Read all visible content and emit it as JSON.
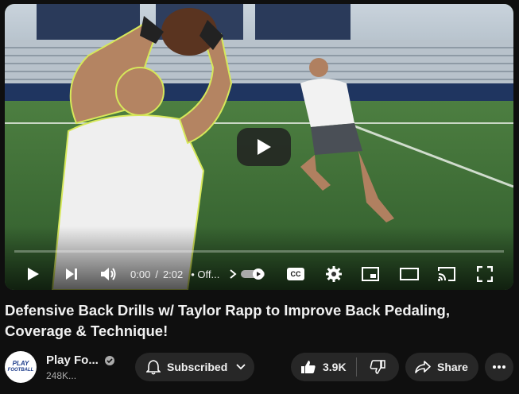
{
  "video": {
    "time_current": "0:00",
    "time_separator": "/",
    "time_total": "2:02",
    "chapter": "• Off...",
    "progress": 0.0,
    "cc_label": "CC"
  },
  "title": "Defensive Back Drills w/ Taylor Rapp to Improve Back Pedaling, Coverage & Technique!",
  "channel": {
    "name": "Play Fo...",
    "subscribers": "248K...",
    "logo_text_top": "PLAY",
    "logo_text_bottom": "FOOTBALL"
  },
  "actions": {
    "subscribe_label": "Subscribed",
    "like_count": "3.9K",
    "share_label": "Share"
  },
  "colors": {
    "accent": "#ff0000",
    "pill_bg": "#272727",
    "background": "#0f0f0f"
  },
  "icons": [
    "play-icon",
    "next-icon",
    "volume-icon",
    "chevron-right-icon",
    "autoplay-toggle",
    "captions-icon",
    "settings-gear-icon",
    "miniplayer-icon",
    "theater-icon",
    "cast-icon",
    "fullscreen-icon",
    "verified-check-icon",
    "bell-icon",
    "chevron-down-icon",
    "thumbs-up-icon",
    "thumbs-down-icon",
    "share-arrow-icon",
    "more-horizontal-icon"
  ]
}
